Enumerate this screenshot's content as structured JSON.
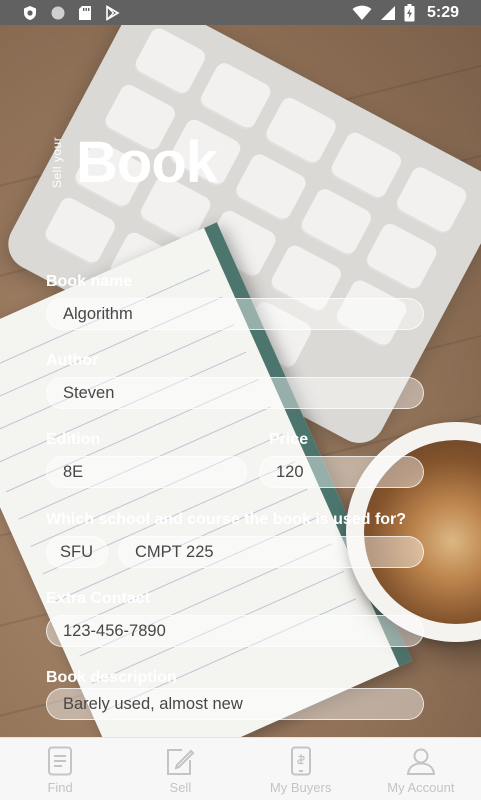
{
  "status_bar": {
    "time": "5:29",
    "icons": [
      "shield-icon",
      "circle-icon",
      "sd-card-icon",
      "play-store-icon",
      "wifi-icon",
      "signal-icon",
      "battery-icon"
    ]
  },
  "header": {
    "prefix": "Sell your",
    "title": "Book"
  },
  "form": {
    "book_name": {
      "label": "Book name",
      "value": "Algorithm"
    },
    "author": {
      "label": "Author",
      "value": "Steven"
    },
    "edition": {
      "label": "Edition",
      "value": "8E"
    },
    "price": {
      "label": "Price",
      "value": "120"
    },
    "school_course": {
      "label": "Which school and course the book is used for?",
      "school": "SFU",
      "course": "CMPT 225"
    },
    "extra_contact": {
      "label": "Extra Contact",
      "value": "123-456-7890"
    },
    "description": {
      "label": "Book description",
      "value": "Barely used, almost new"
    }
  },
  "bottom_nav": {
    "items": [
      {
        "label": "Find",
        "icon": "document-icon"
      },
      {
        "label": "Sell",
        "icon": "edit-icon"
      },
      {
        "label": "My Buyers",
        "icon": "phone-icon"
      },
      {
        "label": "My Account",
        "icon": "user-icon"
      }
    ]
  },
  "colors": {
    "status_bar": "#616161",
    "nav_bg": "#f7f7f7",
    "nav_icon": "#c4c4c4",
    "text_light": "#ffffff"
  }
}
